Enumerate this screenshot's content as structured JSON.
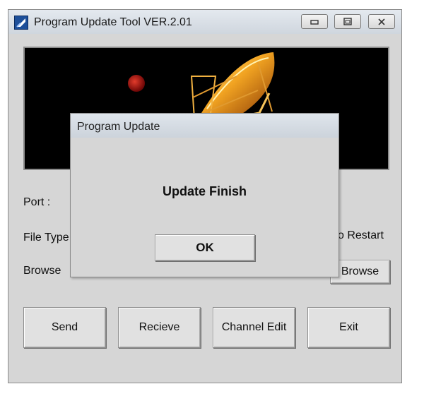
{
  "window": {
    "title": "Program Update Tool VER.2.01",
    "icons": [
      "app-icon",
      "minimize-icon",
      "restore-icon",
      "close-icon"
    ]
  },
  "form": {
    "port_label": "Port :",
    "file_type_label": "File Type",
    "restart_label": "o Restart",
    "browse_label": "Browse",
    "browse_button": "Browse"
  },
  "actions": {
    "send": "Send",
    "receive": "Recieve",
    "channel_edit": "Channel Edit",
    "exit": "Exit"
  },
  "dialog": {
    "title": "Program Update",
    "message": "Update Finish",
    "ok": "OK"
  },
  "colors": {
    "window_bg": "#d6d6d6",
    "banner_bg": "#000000",
    "dish": "#e8a020",
    "planet": "#b01010"
  }
}
